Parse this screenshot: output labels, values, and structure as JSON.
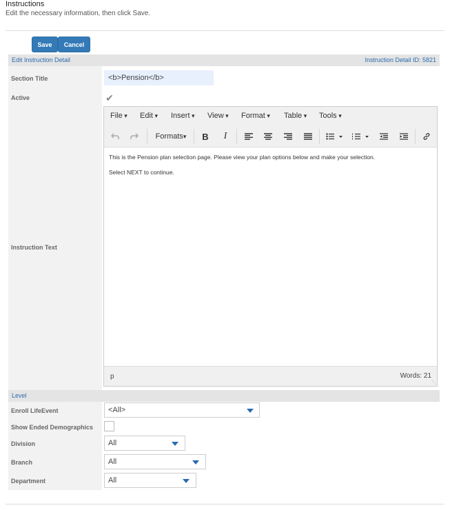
{
  "header": {
    "title": "Instructions",
    "subtitle": "Edit the necessary information, then click Save."
  },
  "buttons": {
    "save": "Save",
    "cancel": "Cancel"
  },
  "detail_bar": {
    "title": "Edit Instruction Detail",
    "id_label": "Instruction Detail ID: 5821"
  },
  "fields": {
    "section_title_label": "Section Title",
    "section_title_value": "<b>Pension</b>",
    "active_label": "Active",
    "active_checked": true,
    "instruction_text_label": "Instruction Text"
  },
  "editor": {
    "menus": [
      "File",
      "Edit",
      "Insert",
      "View",
      "Format",
      "Table",
      "Tools"
    ],
    "formats_label": "Formats",
    "toolbar_icons": [
      "undo-icon",
      "redo-icon",
      "bold-icon",
      "italic-icon",
      "align-left-icon",
      "align-center-icon",
      "align-right-icon",
      "align-justify-icon",
      "bullet-list-icon",
      "numbered-list-icon",
      "outdent-icon",
      "indent-icon",
      "link-icon"
    ],
    "bold_glyph": "B",
    "italic_glyph": "I",
    "paragraphs": [
      "This is the Pension plan selection page. Please view your plan options below and make your selection.",
      "Select NEXT to continue."
    ],
    "status_path": "p",
    "word_count": "Words: 21"
  },
  "level_bar": {
    "title": "Level"
  },
  "level": {
    "enroll_label": "Enroll LifeEvent",
    "enroll_value": "<All>",
    "show_ended_label": "Show Ended Demographics",
    "division_label": "Division",
    "division_value": "All",
    "branch_label": "Branch",
    "branch_value": "All",
    "department_label": "Department",
    "department_value": "All"
  },
  "colors": {
    "primary": "#337ab7",
    "link": "#2a6ab0",
    "panel": "#f2f2f2",
    "bar": "#e4e4e4"
  }
}
